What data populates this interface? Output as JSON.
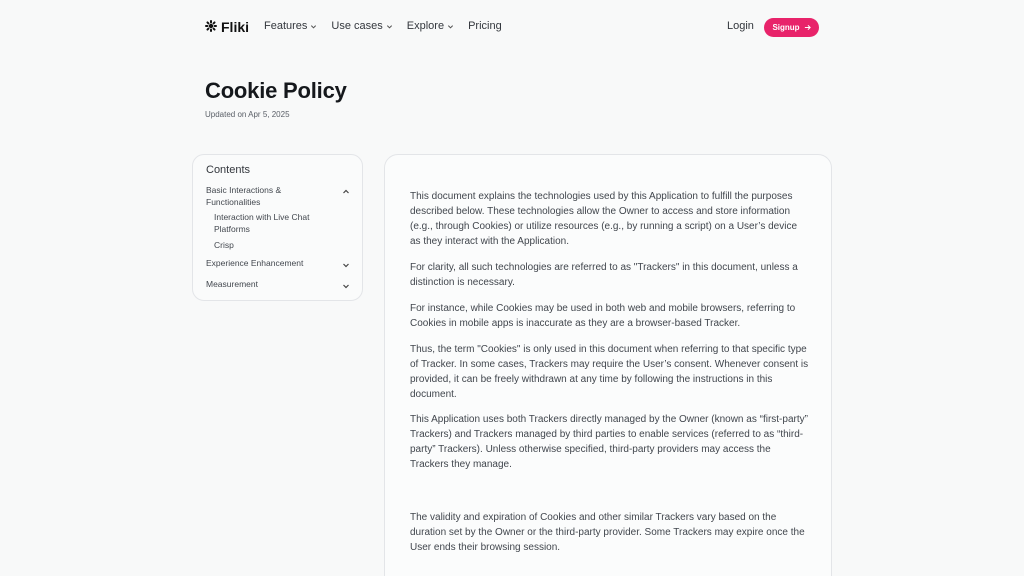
{
  "header": {
    "brand": "Fliki",
    "nav": [
      {
        "label": "Features",
        "has_dropdown": true
      },
      {
        "label": "Use cases",
        "has_dropdown": true
      },
      {
        "label": "Explore",
        "has_dropdown": true
      },
      {
        "label": "Pricing",
        "has_dropdown": false
      }
    ],
    "login_label": "Login",
    "signup_label": "Signup",
    "accent_color": "#e8236a"
  },
  "page": {
    "title": "Cookie Policy",
    "updated": "Updated on Apr 5, 2025"
  },
  "toc": {
    "title": "Contents",
    "sections": [
      {
        "label": "Basic Interactions & Functionalities",
        "expanded": true,
        "children": [
          "Interaction with Live Chat Platforms",
          "Crisp"
        ]
      },
      {
        "label": "Experience Enhancement",
        "expanded": false
      },
      {
        "label": "Measurement",
        "expanded": false
      }
    ]
  },
  "content": {
    "paragraphs": [
      "This document explains the technologies used by this Application to fulfill the purposes described below. These technologies allow the Owner to access and store information (e.g., through Cookies) or utilize resources (e.g., by running a script) on a User’s device as they interact with the Application.",
      "For clarity, all such technologies are referred to as \"Trackers\" in this document, unless a distinction is necessary.",
      "For instance, while Cookies may be used in both web and mobile browsers, referring to Cookies in mobile apps is inaccurate as they are a browser-based Tracker.",
      "Thus, the term \"Cookies\" is only used in this document when referring to that specific type of Tracker. In some cases, Trackers may require the User’s consent. Whenever consent is provided, it can be freely withdrawn at any time by following the instructions in this document.",
      "This Application uses both Trackers directly managed by the Owner (known as “first-party” Trackers) and Trackers managed by third parties to enable services (referred to as “third-party” Trackers). Unless otherwise specified, third-party providers may access the Trackers they manage.",
      "The validity and expiration of Cookies and other similar Trackers vary based on the duration set by the Owner or the third-party provider. Some Trackers may expire once the User ends their browsing session."
    ]
  }
}
